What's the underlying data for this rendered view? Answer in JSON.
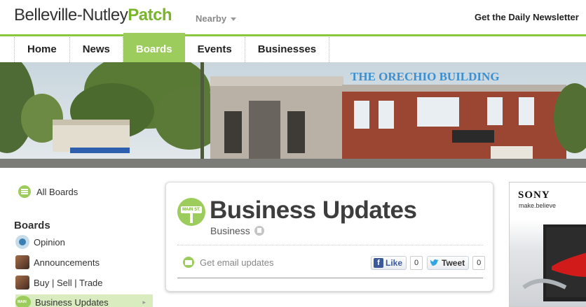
{
  "header": {
    "brand_name": "Belleville-Nutley",
    "brand_patch": "Patch",
    "nearby_label": "Nearby",
    "newsletter_label": "Get the Daily Newsletter"
  },
  "nav": {
    "items": [
      "Home",
      "News",
      "Boards",
      "Events",
      "Businesses"
    ],
    "active": "Boards"
  },
  "banner": {
    "building_sign": "THE ORECHIO BUILDING",
    "sky_color": "#c9d6de",
    "building_color": "#9a4632"
  },
  "sidebar": {
    "all_boards_label": "All Boards",
    "boards_heading": "Boards",
    "items": [
      {
        "label": "Opinion",
        "icon": "opinion-icon"
      },
      {
        "label": "Announcements",
        "icon": "photo-thumb"
      },
      {
        "label": "Buy | Sell | Trade",
        "icon": "photo-thumb"
      },
      {
        "label": "Business Updates",
        "icon": "main-street-icon",
        "active": true
      }
    ],
    "active_arrow": "▸"
  },
  "board": {
    "icon_text": "MAIN ST.",
    "title": "Business Updates",
    "category": "Business",
    "email_label": "Get email updates",
    "like_label": "Like",
    "like_count": "0",
    "tweet_label": "Tweet",
    "tweet_count": "0"
  },
  "ad": {
    "brand": "SONY",
    "tagline": "make.believe"
  },
  "colors": {
    "accent_green": "#8cc63f",
    "facebook_blue": "#3b5998"
  }
}
